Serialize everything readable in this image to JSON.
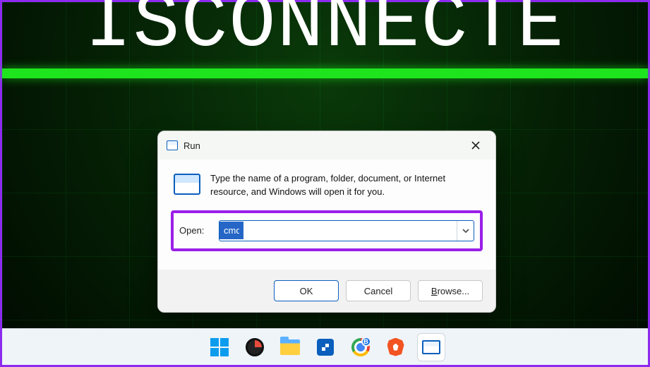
{
  "wallpaper": {
    "text_fragment": "ISCONNECTE"
  },
  "run": {
    "title": "Run",
    "description": "Type the name of a program, folder, document, or Internet resource, and Windows will open it for you.",
    "open_label": "Open:",
    "open_value": "cmd",
    "buttons": {
      "ok": "OK",
      "cancel": "Cancel",
      "browse": "Browse..."
    }
  },
  "taskbar": {
    "items": [
      {
        "name": "start",
        "label": "Start"
      },
      {
        "name": "app-unknown",
        "label": "App"
      },
      {
        "name": "file-explorer",
        "label": "File Explorer"
      },
      {
        "name": "ms-store",
        "label": "Microsoft Store"
      },
      {
        "name": "chrome",
        "label": "Google Chrome",
        "badge": "B"
      },
      {
        "name": "brave",
        "label": "Brave"
      },
      {
        "name": "run",
        "label": "Run",
        "active": true
      }
    ]
  }
}
